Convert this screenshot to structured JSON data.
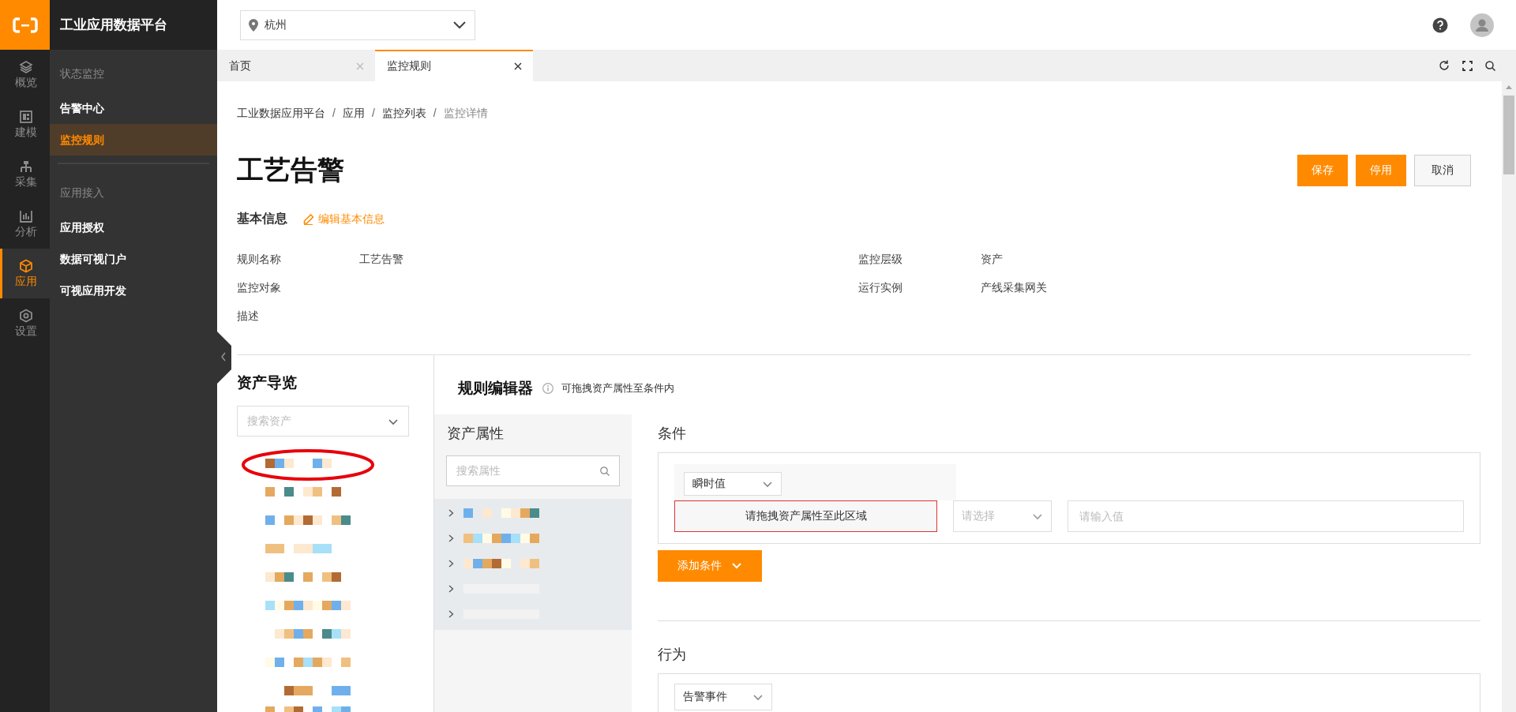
{
  "app": {
    "title": "工业应用数据平台"
  },
  "rail": [
    {
      "label": "概览",
      "selected": false
    },
    {
      "label": "建模",
      "selected": false
    },
    {
      "label": "采集",
      "selected": false
    },
    {
      "label": "分析",
      "selected": false
    },
    {
      "label": "应用",
      "selected": true
    },
    {
      "label": "设置",
      "selected": false
    }
  ],
  "sidebar": {
    "groups": [
      {
        "heading": "状态监控",
        "items": [
          {
            "label": "告警中心",
            "selected": false
          },
          {
            "label": "监控规则",
            "selected": true
          }
        ]
      },
      {
        "heading": "应用接入",
        "items": [
          {
            "label": "应用授权",
            "selected": false
          },
          {
            "label": "数据可视门户",
            "selected": false
          },
          {
            "label": "可视应用开发",
            "selected": false
          }
        ]
      }
    ]
  },
  "header": {
    "location": "杭州"
  },
  "tabs": [
    {
      "label": "首页",
      "selected": false
    },
    {
      "label": "监控规则",
      "selected": true
    }
  ],
  "breadcrumb": [
    {
      "kind": "link",
      "text": "工业数据应用平台"
    },
    {
      "kind": "separator",
      "text": "/"
    },
    {
      "kind": "link",
      "text": "应用"
    },
    {
      "kind": "separator",
      "text": "/"
    },
    {
      "kind": "link",
      "text": "监控列表"
    },
    {
      "kind": "separator",
      "text": "/"
    },
    {
      "kind": "current",
      "text": "监控详情"
    }
  ],
  "page": {
    "title": "工艺告警",
    "buttons": [
      {
        "label": "保存",
        "kind": "primary"
      },
      {
        "label": "停用",
        "kind": "primary"
      },
      {
        "label": "取消",
        "kind": "default"
      }
    ]
  },
  "basic_info": {
    "heading": "基本信息",
    "edit_link": "编辑基本信息",
    "fields": [
      {
        "label": "规则名称",
        "value": "工艺告警"
      },
      {
        "label": "监控层级",
        "value": "资产"
      },
      {
        "label": "监控对象"
      },
      {
        "label": "运行实例",
        "value": "产线采集网关"
      },
      {
        "label": "描述"
      }
    ]
  },
  "asset_nav": {
    "title": "资产导览",
    "search": {
      "placeholder": "搜索资产"
    },
    "items": [
      {
        "kind": "redacted",
        "circled": true
      },
      {
        "kind": "redacted",
        "circled": false
      },
      {
        "kind": "redacted",
        "circled": false
      },
      {
        "kind": "redacted",
        "circled": false
      },
      {
        "kind": "redacted",
        "circled": false
      },
      {
        "kind": "redacted",
        "circled": false
      },
      {
        "kind": "redacted",
        "circled": false
      },
      {
        "kind": "redacted",
        "circled": false
      },
      {
        "kind": "redacted",
        "circled": false
      },
      {
        "kind": "redacted",
        "circled": false
      }
    ]
  },
  "rule_editor": {
    "title": "规则编辑器",
    "hint": "可拖拽资产属性至条件内",
    "attributes": {
      "title": "资产属性",
      "search": {
        "placeholder": "搜索属性"
      },
      "items": [
        {
          "kind": "redacted"
        },
        {
          "kind": "redacted"
        },
        {
          "kind": "redacted"
        },
        {
          "kind": "faint"
        },
        {
          "kind": "faint"
        }
      ]
    },
    "conditions": {
      "title": "条件",
      "value_type": "瞬时值",
      "drop_zone": "请拖拽资产属性至此区域",
      "operator": {
        "placeholder": "请选择"
      },
      "value": {
        "placeholder": "请输入值"
      },
      "add_button": "添加条件"
    },
    "actions": {
      "title": "行为",
      "action_type": "告警事件"
    }
  }
}
